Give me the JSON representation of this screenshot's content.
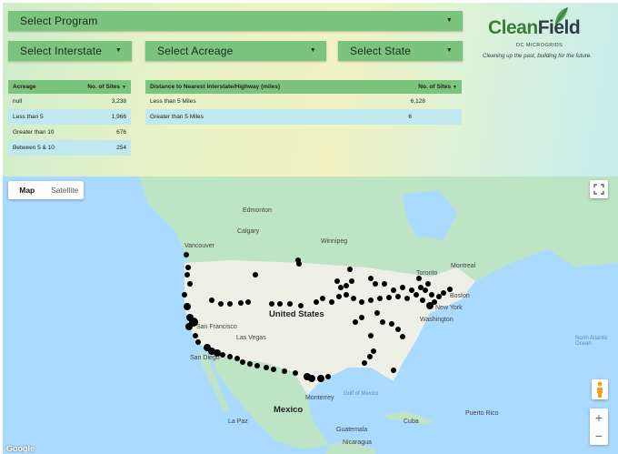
{
  "filters": {
    "program": "Select Program",
    "interstate": "Select Interstate",
    "acreage": "Select Acreage",
    "state": "Select State"
  },
  "acreage_table": {
    "headers": [
      "Acreage",
      "No. of Sites"
    ],
    "rows": [
      [
        "null",
        "3,238"
      ],
      [
        "Less than 5",
        "1,966"
      ],
      [
        "Greater than 10",
        "676"
      ],
      [
        "Between 5 & 10",
        "254"
      ]
    ]
  },
  "distance_table": {
    "headers": [
      "Distance to Nearest Interstate/Highway (miles)",
      "No. of Sites"
    ],
    "rows": [
      [
        "Less than 5 Miles",
        "6,128"
      ],
      [
        "Greater than 5 Miles",
        "6"
      ]
    ]
  },
  "logo": {
    "word1": "Clean",
    "word2": "Field",
    "subtitle": "DC MICROGRIDS",
    "tagline": "Cleaning up the past, building for the future."
  },
  "map": {
    "tabs": [
      "Map",
      "Satellite"
    ],
    "zoom_in": "+",
    "zoom_out": "−",
    "google": "Google",
    "labels": {
      "united_states": "United States",
      "mexico": "Mexico",
      "vancouver": "Vancouver",
      "edmonton": "Edmonton",
      "calgary": "Calgary",
      "winnipeg": "Winnipeg",
      "montreal": "Montreal",
      "toronto": "Toronto",
      "boston": "Boston",
      "new_york": "New York",
      "washington": "Washington",
      "san_francisco": "San Francisco",
      "las_vegas": "Las Vegas",
      "san_diego": "San Diego",
      "monterrey": "Monterrey",
      "cuba": "Cuba",
      "puerto_rico": "Puerto Rico",
      "gulf": "Gulf of Mexico",
      "north_atlantic": "North Atlantic Ocean",
      "guatemala": "Guatemala",
      "nicaragua": "Nicaragua",
      "la_paz": "La Paz"
    },
    "colors": {
      "water": "#aadaff",
      "land": "#bde4c4",
      "usa": "#eef0e6",
      "marker": "#000000"
    }
  }
}
